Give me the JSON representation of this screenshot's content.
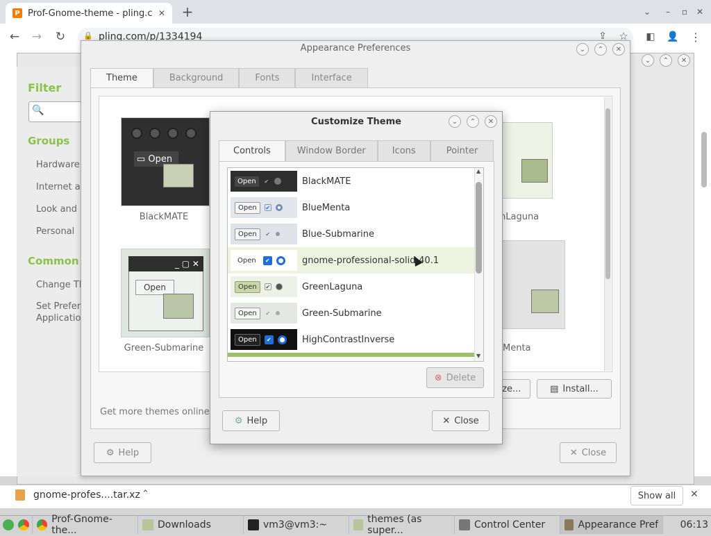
{
  "browser": {
    "tab_title": "Prof-Gnome-theme - pling.co",
    "url": "pling.com/p/1334194",
    "new_tab": "+",
    "win_min": "⌄",
    "win_restore": "–",
    "win_max": "▫",
    "win_close": "✕"
  },
  "control_center": {
    "filter_label": "Filter",
    "groups_label": "Groups",
    "groups": [
      "Hardware",
      "Internet an",
      "Look and F",
      "Personal"
    ],
    "common_label": "Common T",
    "common": [
      "Change Th",
      "Set Prefere",
      "Application"
    ]
  },
  "appearance": {
    "title": "Appearance Preferences",
    "tabs": [
      "Theme",
      "Background",
      "Fonts",
      "Interface"
    ],
    "themes": [
      "BlackMATE",
      "Green-Submarine",
      "enLaguna",
      "Menta"
    ],
    "get_more": "Get more themes online",
    "customize_label": "ize...",
    "install_label": "Install...",
    "help_label": "Help",
    "close_label": "Close"
  },
  "customize": {
    "title": "Customize Theme",
    "tabs": [
      "Controls",
      "Window Border",
      "Icons",
      "Pointer"
    ],
    "items": [
      {
        "name": "BlackMATE",
        "preview_btn": "Open"
      },
      {
        "name": "BlueMenta",
        "preview_btn": "Open"
      },
      {
        "name": "Blue-Submarine",
        "preview_btn": "Open"
      },
      {
        "name": "gnome-professional-solid-40.1",
        "preview_btn": "Open"
      },
      {
        "name": "GreenLaguna",
        "preview_btn": "Open"
      },
      {
        "name": "Green-Submarine",
        "preview_btn": "Open"
      },
      {
        "name": "HighContrastInverse",
        "preview_btn": "Open"
      }
    ],
    "delete_label": "Delete",
    "help_label": "Help",
    "close_label": "Close"
  },
  "download_bar": {
    "file": "gnome-profes....tar.xz",
    "show_all": "Show all"
  },
  "taskbar": {
    "items": [
      "Prof-Gnome-the...",
      "Downloads",
      "vm3@vm3:~",
      "themes (as super...",
      "Control Center",
      "Appearance Prefe..."
    ],
    "clock": "06:13"
  },
  "colors": {
    "accent_green": "#8bc34a",
    "selection": "#eef4e0",
    "checkbox_blue": "#1e6fd9"
  }
}
